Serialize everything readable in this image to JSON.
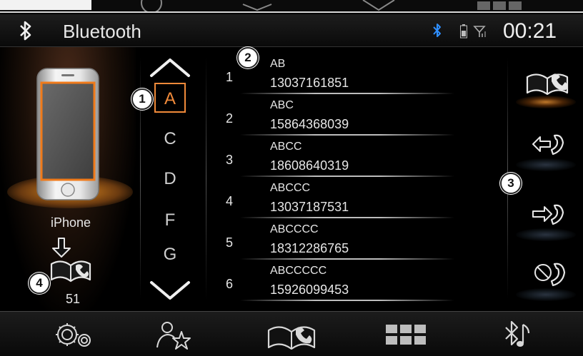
{
  "header": {
    "title": "Bluetooth",
    "clock": "00:21"
  },
  "device": {
    "name": "iPhone",
    "contact_count": "51"
  },
  "alphabet": {
    "letters": [
      "A",
      "C",
      "D",
      "F",
      "G"
    ],
    "selected": "A"
  },
  "contacts": [
    {
      "index": "1",
      "name": "AB",
      "number": "13037161851"
    },
    {
      "index": "2",
      "name": "ABC",
      "number": "15864368039"
    },
    {
      "index": "3",
      "name": "ABCC",
      "number": "18608640319"
    },
    {
      "index": "4",
      "name": "ABCCC",
      "number": "13037187531"
    },
    {
      "index": "5",
      "name": "ABCCCC",
      "number": "18312286765"
    },
    {
      "index": "6",
      "name": "ABCCCCC",
      "number": "15926099453"
    }
  ],
  "callouts": [
    "1",
    "2",
    "3",
    "4"
  ],
  "right_actions": [
    "phonebook-icon",
    "incoming-call-icon",
    "outgoing-call-icon",
    "missed-call-icon"
  ],
  "bottom_nav": [
    "settings-icon",
    "favorites-icon",
    "phonebook-icon",
    "apps-grid-icon",
    "bluetooth-music-icon"
  ],
  "colors": {
    "accent": "#f08a3a",
    "bluetooth_blue": "#2f8fff"
  }
}
